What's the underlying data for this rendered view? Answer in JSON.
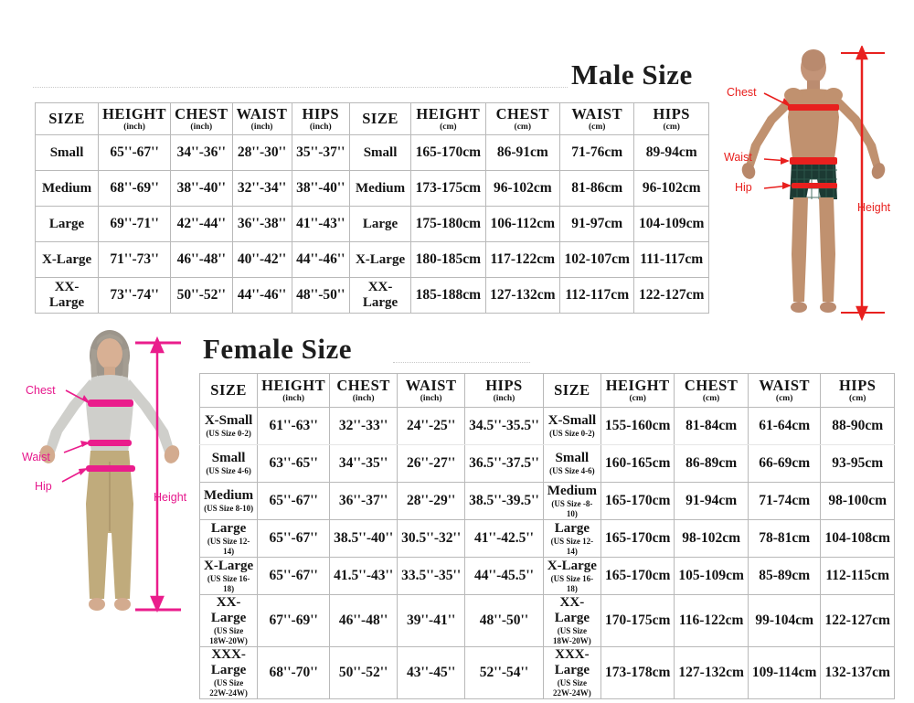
{
  "male": {
    "title": "Male Size",
    "headers_inch": [
      {
        "name": "SIZE",
        "unit": ""
      },
      {
        "name": "HEIGHT",
        "unit": "(inch)"
      },
      {
        "name": "CHEST",
        "unit": "(inch)"
      },
      {
        "name": "WAIST",
        "unit": "(inch)"
      },
      {
        "name": "HIPS",
        "unit": "(inch)"
      }
    ],
    "headers_cm": [
      {
        "name": "SIZE",
        "unit": ""
      },
      {
        "name": "HEIGHT",
        "unit": "(cm)"
      },
      {
        "name": "CHEST",
        "unit": "(cm)"
      },
      {
        "name": "WAIST",
        "unit": "(cm)"
      },
      {
        "name": "HIPS",
        "unit": "(cm)"
      }
    ],
    "rows": [
      {
        "size": "Small",
        "height_in": "65''-67''",
        "chest_in": "34''-36''",
        "waist_in": "28''-30''",
        "hips_in": "35''-37''",
        "size_cm": "Small",
        "height_cm": "165-170cm",
        "chest_cm": "86-91cm",
        "waist_cm": "71-76cm",
        "hips_cm": "89-94cm"
      },
      {
        "size": "Medium",
        "height_in": "68''-69''",
        "chest_in": "38''-40''",
        "waist_in": "32''-34''",
        "hips_in": "38''-40''",
        "size_cm": "Medium",
        "height_cm": "173-175cm",
        "chest_cm": "96-102cm",
        "waist_cm": "81-86cm",
        "hips_cm": "96-102cm"
      },
      {
        "size": "Large",
        "height_in": "69''-71''",
        "chest_in": "42''-44''",
        "waist_in": "36''-38''",
        "hips_in": "41''-43''",
        "size_cm": "Large",
        "height_cm": "175-180cm",
        "chest_cm": "106-112cm",
        "waist_cm": "91-97cm",
        "hips_cm": "104-109cm"
      },
      {
        "size": "X-Large",
        "height_in": "71''-73''",
        "chest_in": "46''-48''",
        "waist_in": "40''-42''",
        "hips_in": "44''-46''",
        "size_cm": "X-Large",
        "height_cm": "180-185cm",
        "chest_cm": "117-122cm",
        "waist_cm": "102-107cm",
        "hips_cm": "111-117cm"
      },
      {
        "size": "XX-Large",
        "height_in": "73''-74''",
        "chest_in": "50''-52''",
        "waist_in": "44''-46''",
        "hips_in": "48''-50''",
        "size_cm": "XX-Large",
        "height_cm": "185-188cm",
        "chest_cm": "127-132cm",
        "waist_cm": "112-117cm",
        "hips_cm": "122-127cm"
      }
    ],
    "figure": {
      "chest_label": "Chest",
      "waist_label": "Waist",
      "hip_label": "Hip",
      "height_label": "Height",
      "accent_color": "#e8201e"
    }
  },
  "female": {
    "title": "Female Size",
    "headers_inch": [
      {
        "name": "SIZE",
        "unit": ""
      },
      {
        "name": "HEIGHT",
        "unit": "(inch)"
      },
      {
        "name": "CHEST",
        "unit": "(inch)"
      },
      {
        "name": "WAIST",
        "unit": "(inch)"
      },
      {
        "name": "HIPS",
        "unit": "(inch)"
      }
    ],
    "headers_cm": [
      {
        "name": "SIZE",
        "unit": ""
      },
      {
        "name": "HEIGHT",
        "unit": "(cm)"
      },
      {
        "name": "CHEST",
        "unit": "(cm)"
      },
      {
        "name": "WAIST",
        "unit": "(cm)"
      },
      {
        "name": "HIPS",
        "unit": "(cm)"
      }
    ],
    "rows": [
      {
        "size": "X-Small",
        "size_sub": "(US Size 0-2)",
        "height_in": "61''-63''",
        "chest_in": "32''-33''",
        "waist_in": "24''-25''",
        "hips_in": "34.5''-35.5''",
        "size_cm": "X-Small",
        "size_cm_sub": "(US Size 0-2)",
        "height_cm": "155-160cm",
        "chest_cm": "81-84cm",
        "waist_cm": "61-64cm",
        "hips_cm": "88-90cm"
      },
      {
        "size": "Small",
        "size_sub": "(US Size 4-6)",
        "height_in": "63''-65''",
        "chest_in": "34''-35''",
        "waist_in": "26''-27''",
        "hips_in": "36.5''-37.5''",
        "size_cm": "Small",
        "size_cm_sub": "(US Size 4-6)",
        "height_cm": "160-165cm",
        "chest_cm": "86-89cm",
        "waist_cm": "66-69cm",
        "hips_cm": "93-95cm"
      },
      {
        "size": "Medium",
        "size_sub": "(US Size 8-10)",
        "height_in": "65''-67''",
        "chest_in": "36''-37''",
        "waist_in": "28''-29''",
        "hips_in": "38.5''-39.5''",
        "size_cm": "Medium",
        "size_cm_sub": "(US Size -8-10)",
        "height_cm": "165-170cm",
        "chest_cm": "91-94cm",
        "waist_cm": "71-74cm",
        "hips_cm": "98-100cm"
      },
      {
        "size": "Large",
        "size_sub": "(US Size 12-14)",
        "height_in": "65''-67''",
        "chest_in": "38.5''-40''",
        "waist_in": "30.5''-32''",
        "hips_in": "41''-42.5''",
        "size_cm": "Large",
        "size_cm_sub": "(US Size 12-14)",
        "height_cm": "165-170cm",
        "chest_cm": "98-102cm",
        "waist_cm": "78-81cm",
        "hips_cm": "104-108cm"
      },
      {
        "size": "X-Large",
        "size_sub": "(US Size 16-18)",
        "height_in": "65''-67''",
        "chest_in": "41.5''-43''",
        "waist_in": "33.5''-35''",
        "hips_in": "44''-45.5''",
        "size_cm": "X-Large",
        "size_cm_sub": "(US Size 16-18)",
        "height_cm": "165-170cm",
        "chest_cm": "105-109cm",
        "waist_cm": "85-89cm",
        "hips_cm": "112-115cm"
      },
      {
        "size": "XX-Large",
        "size_sub": "(US Size 18W-20W)",
        "height_in": "67''-69''",
        "chest_in": "46''-48''",
        "waist_in": "39''-41''",
        "hips_in": "48''-50''",
        "size_cm": "XX-Large",
        "size_cm_sub": "(US Size 18W-20W)",
        "height_cm": "170-175cm",
        "chest_cm": "116-122cm",
        "waist_cm": "99-104cm",
        "hips_cm": "122-127cm"
      },
      {
        "size": "XXX-Large",
        "size_sub": "(US Size 22W-24W)",
        "height_in": "68''-70''",
        "chest_in": "50''-52''",
        "waist_in": "43''-45''",
        "hips_in": "52''-54''",
        "size_cm": "XXX-Large",
        "size_cm_sub": "(US Size 22W-24W)",
        "height_cm": "173-178cm",
        "chest_cm": "127-132cm",
        "waist_cm": "109-114cm",
        "hips_cm": "132-137cm"
      }
    ],
    "figure": {
      "chest_label": "Chest",
      "waist_label": "Waist",
      "hip_label": "Hip",
      "height_label": "Height",
      "accent_color": "#e6188c"
    }
  }
}
